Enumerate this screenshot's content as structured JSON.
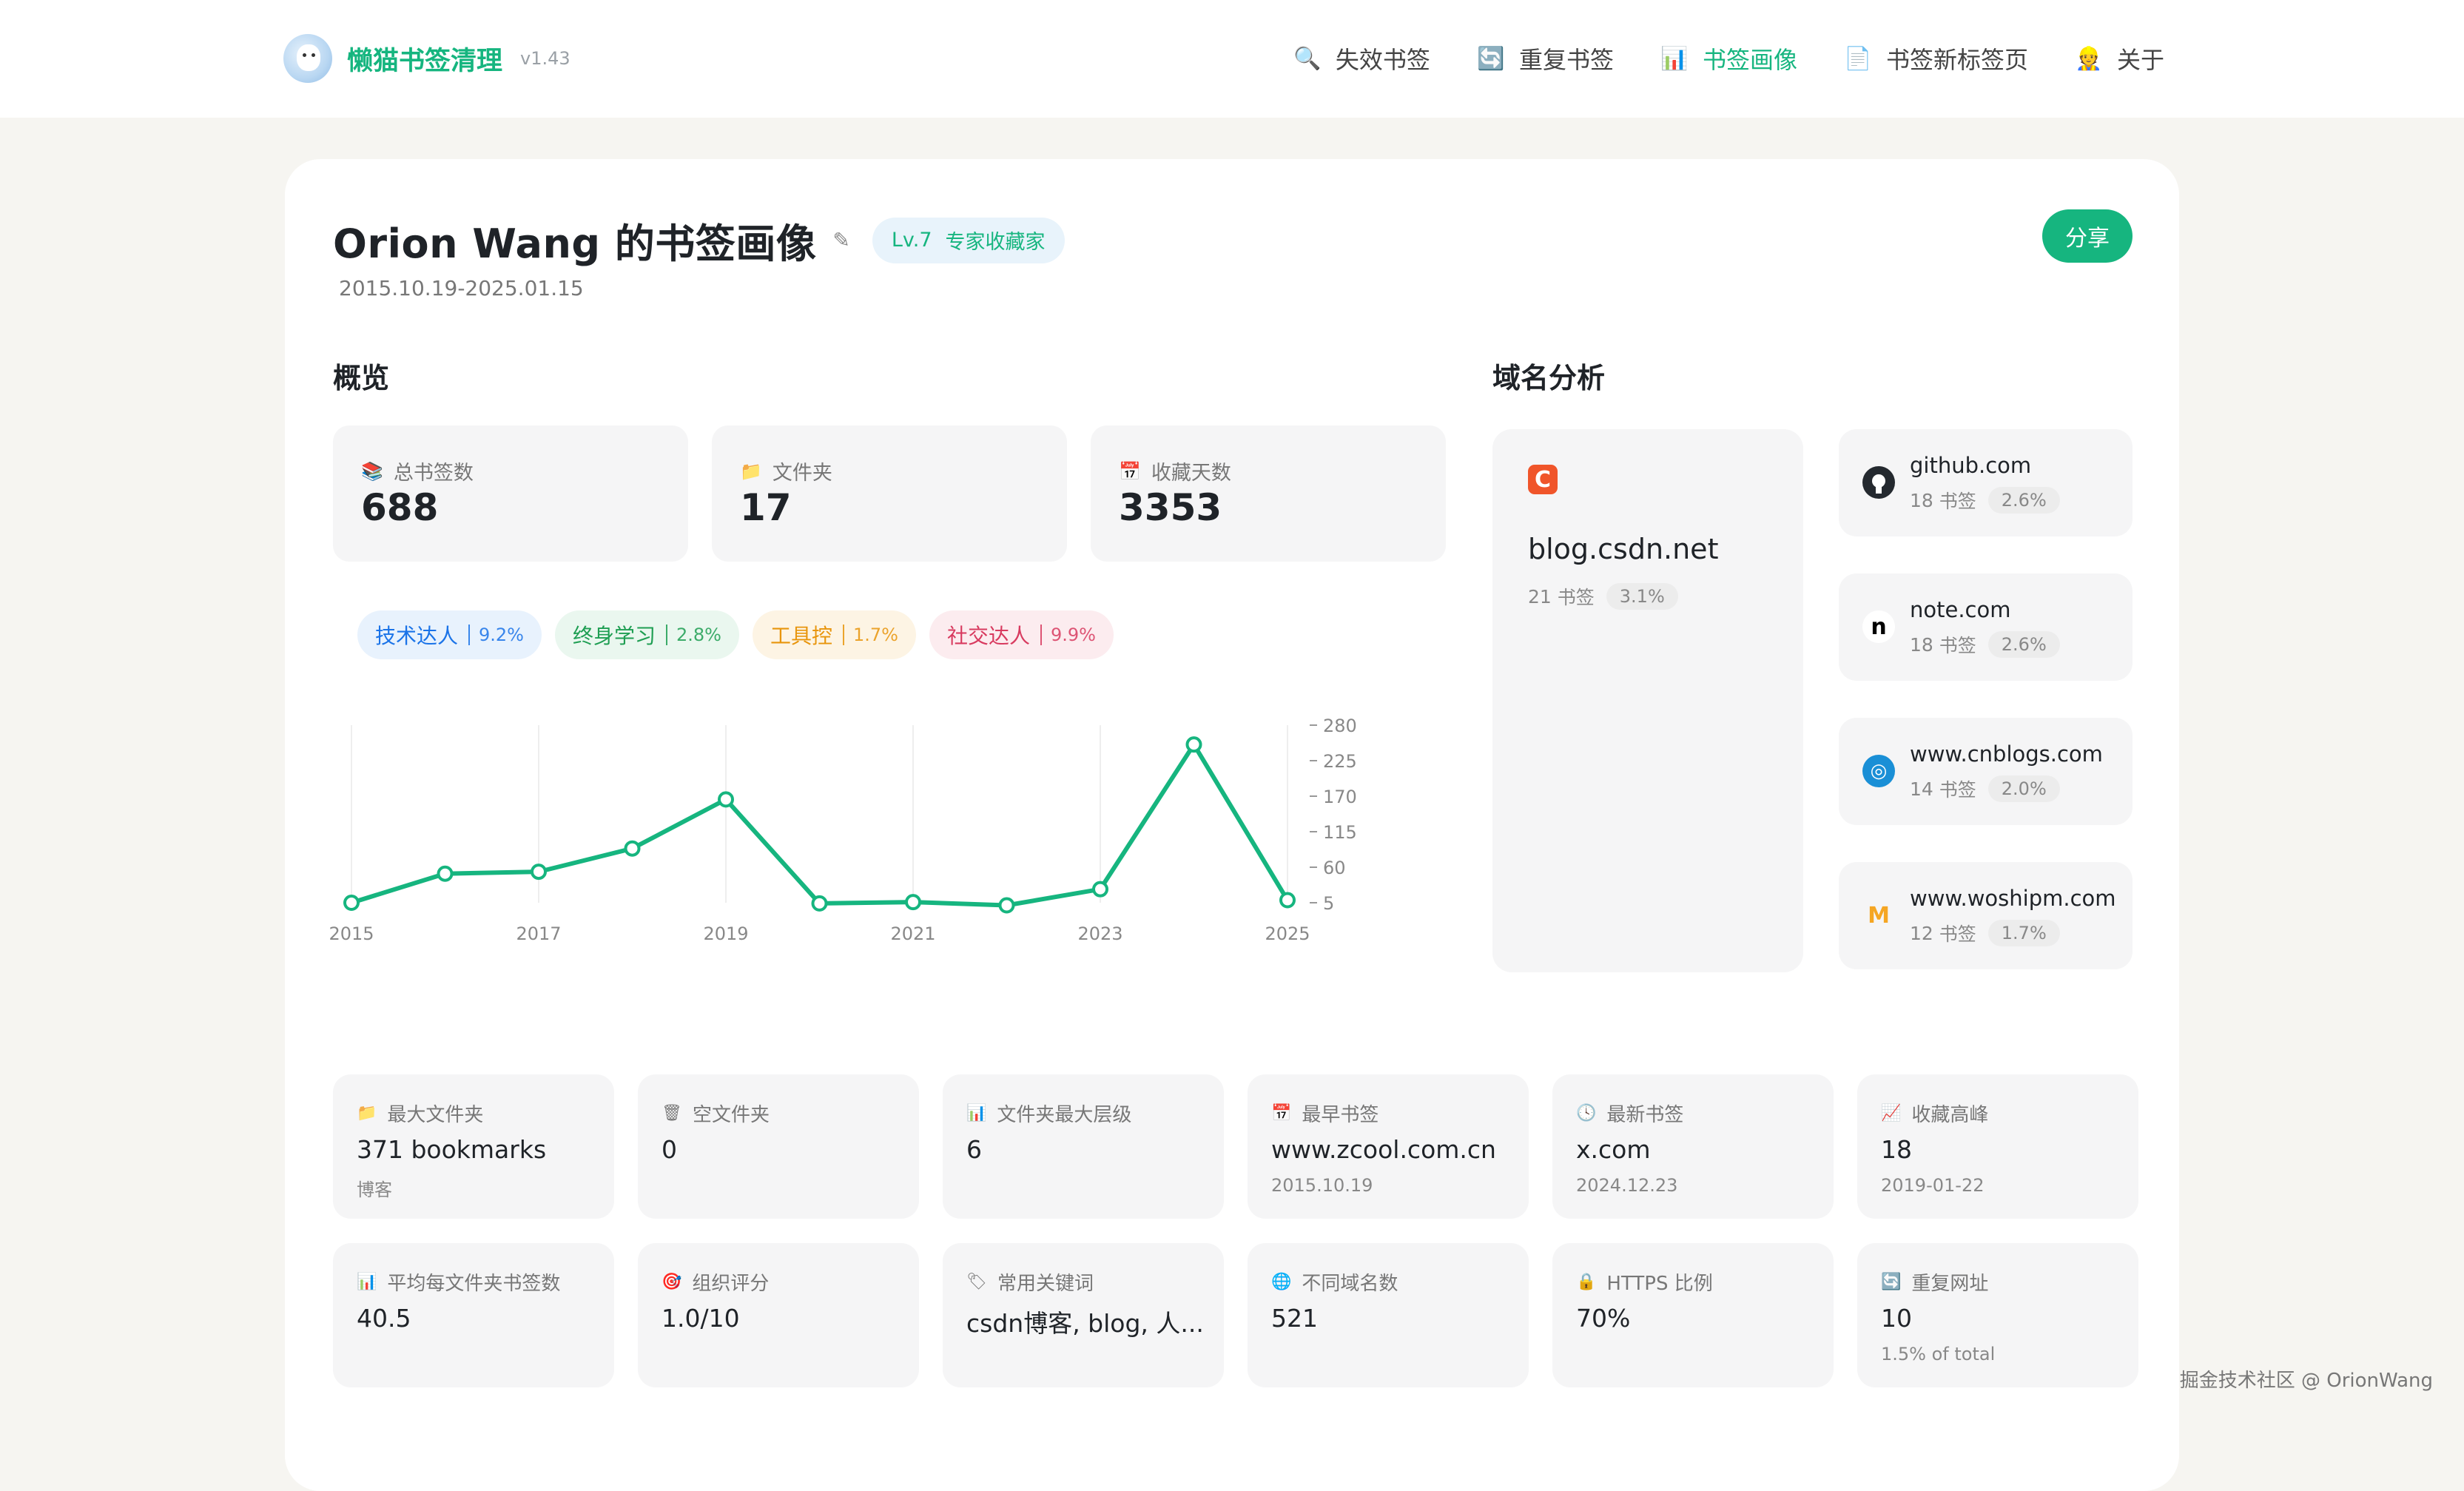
{
  "brand": {
    "name": "懒猫书签清理",
    "version": "v1.43"
  },
  "nav": [
    {
      "label": "失效书签",
      "icon": "magnifier-icon",
      "glyph": "🔍",
      "active": false
    },
    {
      "label": "重复书签",
      "icon": "refresh-icon",
      "glyph": "🔄",
      "active": false
    },
    {
      "label": "书签画像",
      "icon": "bar-chart-icon",
      "glyph": "📊",
      "active": true
    },
    {
      "label": "书签新标签页",
      "icon": "document-icon",
      "glyph": "📄",
      "active": false
    },
    {
      "label": "关于",
      "icon": "person-icon",
      "glyph": "👷",
      "active": false
    }
  ],
  "profile": {
    "title": "Orion Wang 的书签画像",
    "level": "Lv.7",
    "level_name": "专家收藏家",
    "date_range": "2015.10.19-2025.01.15",
    "share_label": "分享"
  },
  "overview": {
    "heading": "概览",
    "stats": [
      {
        "label": "总书签数",
        "value": "688",
        "icon": "books-icon",
        "glyph": "📚"
      },
      {
        "label": "文件夹",
        "value": "17",
        "icon": "folder-icon",
        "glyph": "📁"
      },
      {
        "label": "收藏天数",
        "value": "3353",
        "icon": "calendar-icon",
        "glyph": "📅"
      }
    ],
    "tags": [
      {
        "label": "技术达人",
        "pct": "9.2%",
        "color": "#1a73e8",
        "bg": "#e8f2fd"
      },
      {
        "label": "终身学习",
        "pct": "2.8%",
        "color": "#1e9e52",
        "bg": "#eaf7ef"
      },
      {
        "label": "工具控",
        "pct": "1.7%",
        "color": "#e8950c",
        "bg": "#fdf4e4"
      },
      {
        "label": "社交达人",
        "pct": "9.9%",
        "color": "#d83a5f",
        "bg": "#fcecef"
      }
    ]
  },
  "chart_data": {
    "type": "line",
    "x": [
      2015,
      2016,
      2017,
      2018,
      2019,
      2020,
      2021,
      2022,
      2023,
      2024,
      2025
    ],
    "values": [
      5,
      50,
      53,
      89,
      165,
      4,
      6,
      1,
      26,
      250,
      9
    ],
    "x_tick_labels": [
      "2015",
      "2017",
      "2019",
      "2021",
      "2023",
      "2025"
    ],
    "y_ticks": [
      280,
      225,
      170,
      115,
      60,
      5
    ],
    "ylim": [
      5,
      280
    ],
    "line_color": "#16b57f",
    "y_axis_side": "right",
    "grid": "vertical"
  },
  "domains": {
    "heading": "域名分析",
    "unit": "书签",
    "top": {
      "name": "blog.csdn.net",
      "count": "21",
      "pct": "3.1%",
      "icon": "csdn-icon",
      "glyph": "C"
    },
    "others": [
      {
        "name": "github.com",
        "count": "18",
        "pct": "2.6%",
        "icon": "github-icon",
        "glyph": "●"
      },
      {
        "name": "note.com",
        "count": "18",
        "pct": "2.6%",
        "icon": "note-icon",
        "glyph": "n"
      },
      {
        "name": "www.cnblogs.com",
        "count": "14",
        "pct": "2.0%",
        "icon": "cnblogs-icon",
        "glyph": "◎"
      },
      {
        "name": "www.woshipm.com",
        "count": "12",
        "pct": "1.7%",
        "icon": "woshipm-icon",
        "glyph": "M"
      }
    ]
  },
  "details": [
    {
      "label": "最大文件夹",
      "value": "371 bookmarks",
      "sub": "博客",
      "icon": "folder-icon",
      "glyph": "📁"
    },
    {
      "label": "空文件夹",
      "value": "0",
      "sub": "",
      "icon": "trash-icon",
      "glyph": "🗑"
    },
    {
      "label": "文件夹最大层级",
      "value": "6",
      "sub": "",
      "icon": "bar-chart-icon",
      "glyph": "📊"
    },
    {
      "label": "最早书签",
      "value": "www.zcool.com.cn",
      "sub": "2015.10.19",
      "icon": "calendar-icon",
      "glyph": "📅"
    },
    {
      "label": "最新书签",
      "value": "x.com",
      "sub": "2024.12.23",
      "icon": "clock-icon",
      "glyph": "🕓"
    },
    {
      "label": "收藏高峰",
      "value": "18",
      "sub": "2019-01-22",
      "icon": "trend-up-icon",
      "glyph": "📈"
    },
    {
      "label": "平均每文件夹书签数",
      "value": "40.5",
      "sub": "",
      "icon": "bar-chart-icon",
      "glyph": "📊"
    },
    {
      "label": "组织评分",
      "value": "1.0/10",
      "sub": "",
      "icon": "target-icon",
      "glyph": "🎯"
    },
    {
      "label": "常用关键词",
      "value": "csdn博客, blog, 人...",
      "sub": "",
      "icon": "label-icon",
      "glyph": "🏷"
    },
    {
      "label": "不同域名数",
      "value": "521",
      "sub": "",
      "icon": "globe-icon",
      "glyph": "🌐"
    },
    {
      "label": "HTTPS 比例",
      "value": "70%",
      "sub": "",
      "icon": "lock-icon",
      "glyph": "🔒"
    },
    {
      "label": "重复网址",
      "value": "10",
      "sub": "1.5% of total",
      "icon": "repeat-icon",
      "glyph": "🔄"
    }
  ],
  "credit": "掘金技术社区 @ OrionWang"
}
